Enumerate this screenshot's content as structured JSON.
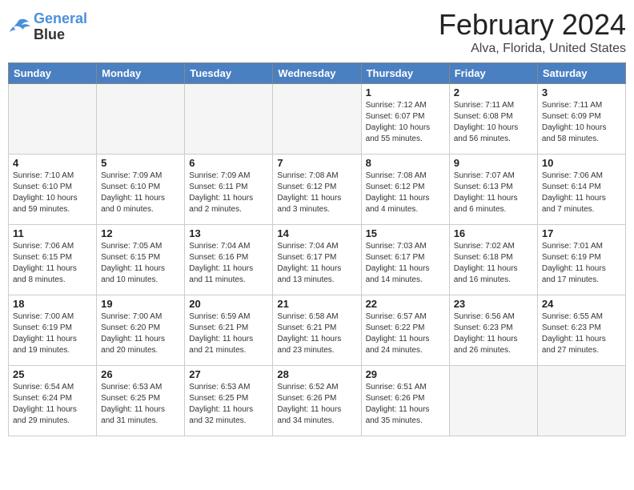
{
  "header": {
    "logo_line1": "General",
    "logo_line2": "Blue",
    "month": "February 2024",
    "location": "Alva, Florida, United States"
  },
  "weekdays": [
    "Sunday",
    "Monday",
    "Tuesday",
    "Wednesday",
    "Thursday",
    "Friday",
    "Saturday"
  ],
  "weeks": [
    [
      {
        "day": "",
        "empty": true
      },
      {
        "day": "",
        "empty": true
      },
      {
        "day": "",
        "empty": true
      },
      {
        "day": "",
        "empty": true
      },
      {
        "day": "1",
        "rise": "7:12 AM",
        "set": "6:07 PM",
        "daylight": "10 hours and 55 minutes."
      },
      {
        "day": "2",
        "rise": "7:11 AM",
        "set": "6:08 PM",
        "daylight": "10 hours and 56 minutes."
      },
      {
        "day": "3",
        "rise": "7:11 AM",
        "set": "6:09 PM",
        "daylight": "10 hours and 58 minutes."
      }
    ],
    [
      {
        "day": "4",
        "rise": "7:10 AM",
        "set": "6:10 PM",
        "daylight": "10 hours and 59 minutes."
      },
      {
        "day": "5",
        "rise": "7:09 AM",
        "set": "6:10 PM",
        "daylight": "11 hours and 0 minutes."
      },
      {
        "day": "6",
        "rise": "7:09 AM",
        "set": "6:11 PM",
        "daylight": "11 hours and 2 minutes."
      },
      {
        "day": "7",
        "rise": "7:08 AM",
        "set": "6:12 PM",
        "daylight": "11 hours and 3 minutes."
      },
      {
        "day": "8",
        "rise": "7:08 AM",
        "set": "6:12 PM",
        "daylight": "11 hours and 4 minutes."
      },
      {
        "day": "9",
        "rise": "7:07 AM",
        "set": "6:13 PM",
        "daylight": "11 hours and 6 minutes."
      },
      {
        "day": "10",
        "rise": "7:06 AM",
        "set": "6:14 PM",
        "daylight": "11 hours and 7 minutes."
      }
    ],
    [
      {
        "day": "11",
        "rise": "7:06 AM",
        "set": "6:15 PM",
        "daylight": "11 hours and 8 minutes."
      },
      {
        "day": "12",
        "rise": "7:05 AM",
        "set": "6:15 PM",
        "daylight": "11 hours and 10 minutes."
      },
      {
        "day": "13",
        "rise": "7:04 AM",
        "set": "6:16 PM",
        "daylight": "11 hours and 11 minutes."
      },
      {
        "day": "14",
        "rise": "7:04 AM",
        "set": "6:17 PM",
        "daylight": "11 hours and 13 minutes."
      },
      {
        "day": "15",
        "rise": "7:03 AM",
        "set": "6:17 PM",
        "daylight": "11 hours and 14 minutes."
      },
      {
        "day": "16",
        "rise": "7:02 AM",
        "set": "6:18 PM",
        "daylight": "11 hours and 16 minutes."
      },
      {
        "day": "17",
        "rise": "7:01 AM",
        "set": "6:19 PM",
        "daylight": "11 hours and 17 minutes."
      }
    ],
    [
      {
        "day": "18",
        "rise": "7:00 AM",
        "set": "6:19 PM",
        "daylight": "11 hours and 19 minutes."
      },
      {
        "day": "19",
        "rise": "7:00 AM",
        "set": "6:20 PM",
        "daylight": "11 hours and 20 minutes."
      },
      {
        "day": "20",
        "rise": "6:59 AM",
        "set": "6:21 PM",
        "daylight": "11 hours and 21 minutes."
      },
      {
        "day": "21",
        "rise": "6:58 AM",
        "set": "6:21 PM",
        "daylight": "11 hours and 23 minutes."
      },
      {
        "day": "22",
        "rise": "6:57 AM",
        "set": "6:22 PM",
        "daylight": "11 hours and 24 minutes."
      },
      {
        "day": "23",
        "rise": "6:56 AM",
        "set": "6:23 PM",
        "daylight": "11 hours and 26 minutes."
      },
      {
        "day": "24",
        "rise": "6:55 AM",
        "set": "6:23 PM",
        "daylight": "11 hours and 27 minutes."
      }
    ],
    [
      {
        "day": "25",
        "rise": "6:54 AM",
        "set": "6:24 PM",
        "daylight": "11 hours and 29 minutes."
      },
      {
        "day": "26",
        "rise": "6:53 AM",
        "set": "6:25 PM",
        "daylight": "11 hours and 31 minutes."
      },
      {
        "day": "27",
        "rise": "6:53 AM",
        "set": "6:25 PM",
        "daylight": "11 hours and 32 minutes."
      },
      {
        "day": "28",
        "rise": "6:52 AM",
        "set": "6:26 PM",
        "daylight": "11 hours and 34 minutes."
      },
      {
        "day": "29",
        "rise": "6:51 AM",
        "set": "6:26 PM",
        "daylight": "11 hours and 35 minutes."
      },
      {
        "day": "",
        "empty": true
      },
      {
        "day": "",
        "empty": true
      }
    ]
  ]
}
